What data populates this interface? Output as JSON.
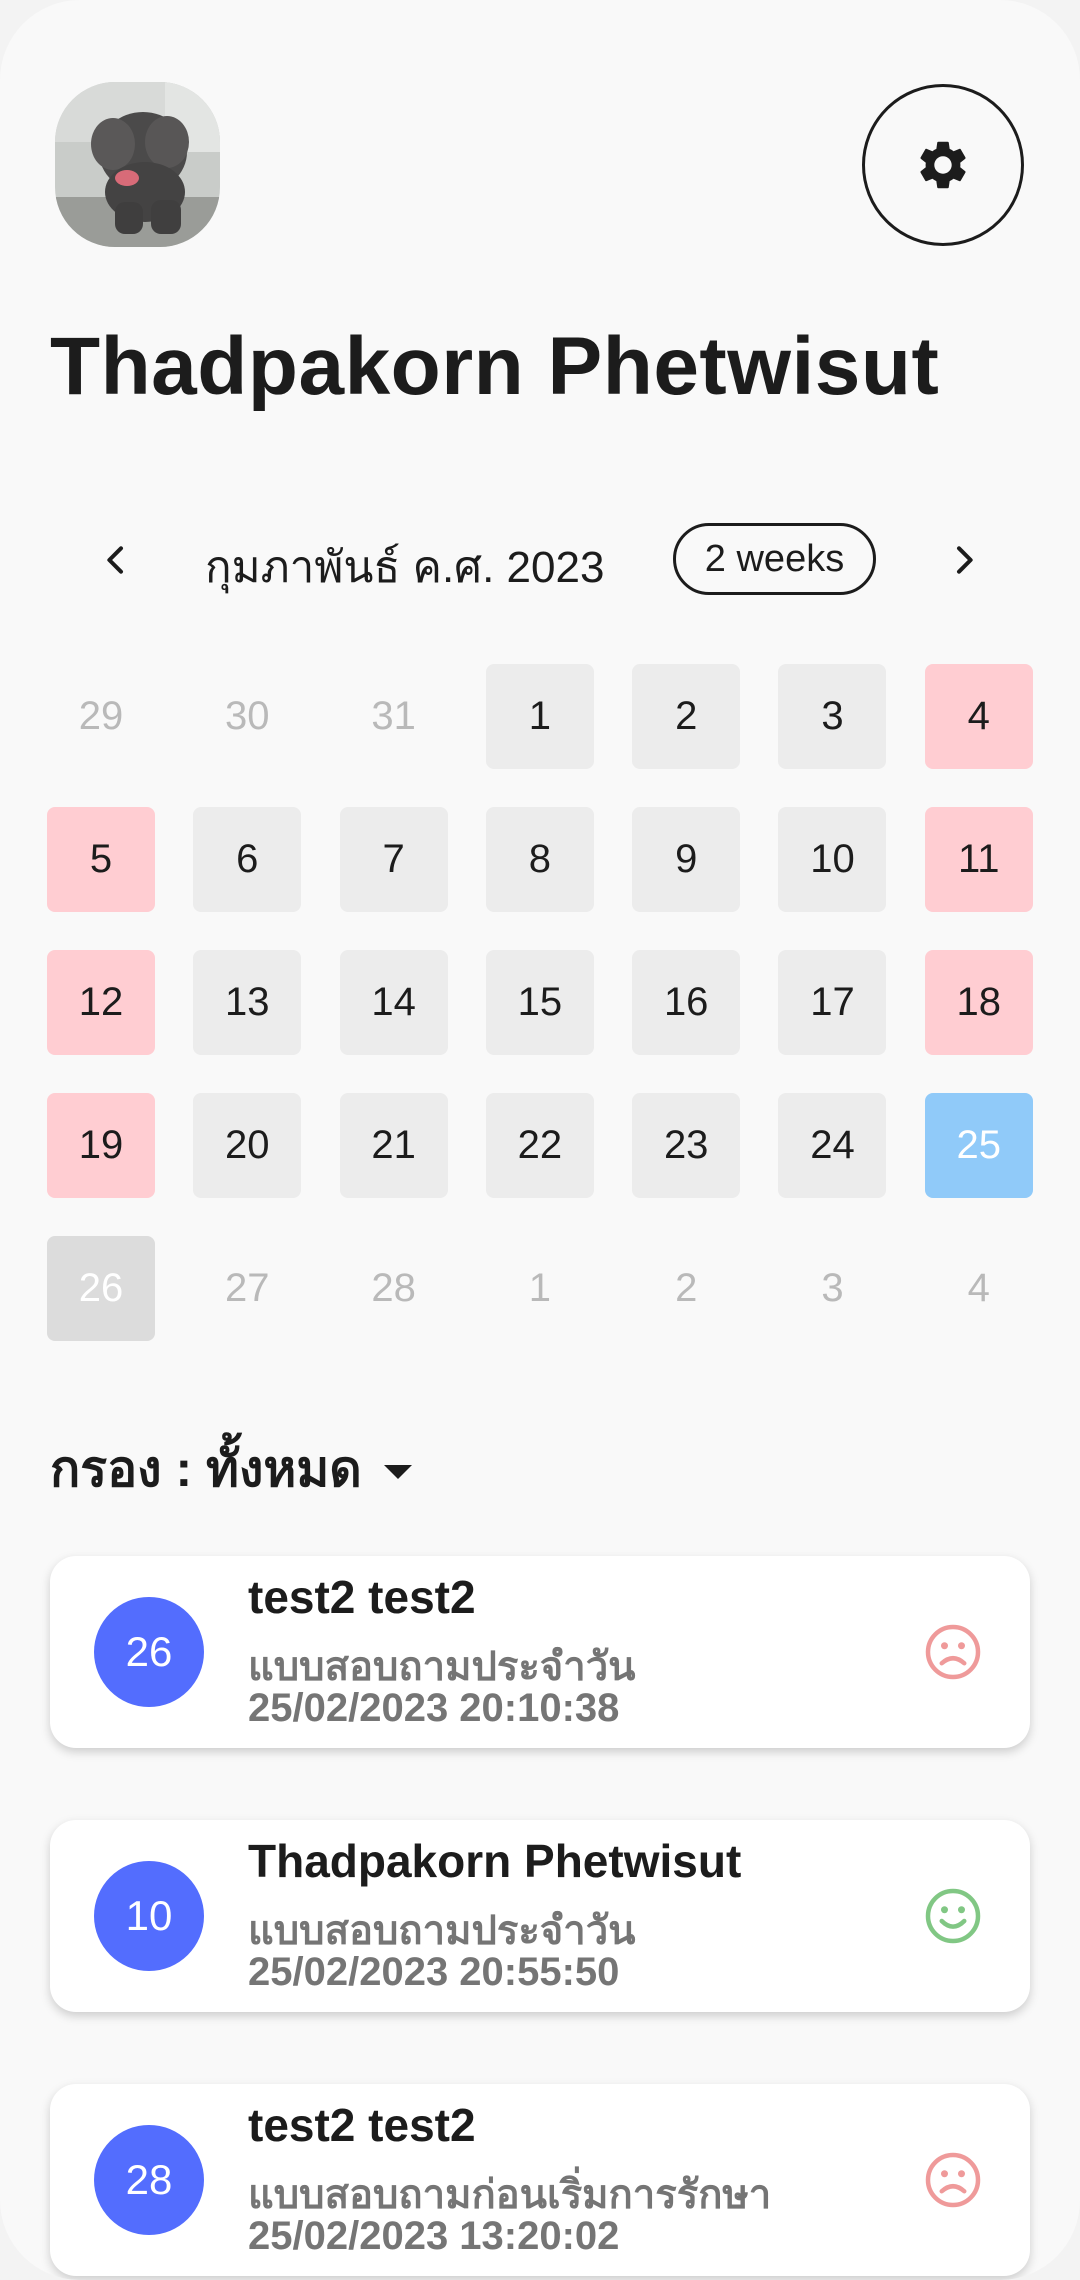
{
  "user": {
    "name": "Thadpakorn Phetwisut"
  },
  "header": {
    "settings_icon": "gear-icon",
    "avatar": "elephant-photo"
  },
  "calendar": {
    "month_label": "กุมภาพันธ์ ค.ศ. 2023",
    "range_label": "2 weeks",
    "days": [
      {
        "label": "29",
        "state": "outside"
      },
      {
        "label": "30",
        "state": "outside"
      },
      {
        "label": "31",
        "state": "outside"
      },
      {
        "label": "1",
        "state": "normal"
      },
      {
        "label": "2",
        "state": "normal"
      },
      {
        "label": "3",
        "state": "normal"
      },
      {
        "label": "4",
        "state": "weekend"
      },
      {
        "label": "5",
        "state": "weekend"
      },
      {
        "label": "6",
        "state": "normal"
      },
      {
        "label": "7",
        "state": "normal"
      },
      {
        "label": "8",
        "state": "normal"
      },
      {
        "label": "9",
        "state": "normal"
      },
      {
        "label": "10",
        "state": "normal"
      },
      {
        "label": "11",
        "state": "weekend"
      },
      {
        "label": "12",
        "state": "weekend"
      },
      {
        "label": "13",
        "state": "normal"
      },
      {
        "label": "14",
        "state": "normal"
      },
      {
        "label": "15",
        "state": "normal"
      },
      {
        "label": "16",
        "state": "normal"
      },
      {
        "label": "17",
        "state": "normal"
      },
      {
        "label": "18",
        "state": "weekend"
      },
      {
        "label": "19",
        "state": "weekend"
      },
      {
        "label": "20",
        "state": "normal"
      },
      {
        "label": "21",
        "state": "normal"
      },
      {
        "label": "22",
        "state": "normal"
      },
      {
        "label": "23",
        "state": "normal"
      },
      {
        "label": "24",
        "state": "normal"
      },
      {
        "label": "25",
        "state": "today"
      },
      {
        "label": "26",
        "state": "future"
      },
      {
        "label": "27",
        "state": "outside"
      },
      {
        "label": "28",
        "state": "outside"
      },
      {
        "label": "1",
        "state": "outside"
      },
      {
        "label": "2",
        "state": "outside"
      },
      {
        "label": "3",
        "state": "outside"
      },
      {
        "label": "4",
        "state": "outside"
      }
    ]
  },
  "filter": {
    "label": "กรอง : ทั้งหมด"
  },
  "entries": [
    {
      "badge": "26",
      "name": "test2 test2",
      "type": "แบบสอบถามประจำวัน",
      "time": "25/02/2023 20:10:38",
      "mood": "sad"
    },
    {
      "badge": "10",
      "name": "Thadpakorn Phetwisut",
      "type": "แบบสอบถามประจำวัน",
      "time": "25/02/2023 20:55:50",
      "mood": "happy"
    },
    {
      "badge": "28",
      "name": "test2 test2",
      "type": "แบบสอบถามก่อนเริ่มการรักษา",
      "time": "25/02/2023 13:20:02",
      "mood": "sad"
    }
  ],
  "colors": {
    "badge": "#536dfe",
    "weekend": "#ffcdd2",
    "today": "#90caf9",
    "mood_sad": "#ef9a9a",
    "mood_happy": "#81c784"
  }
}
